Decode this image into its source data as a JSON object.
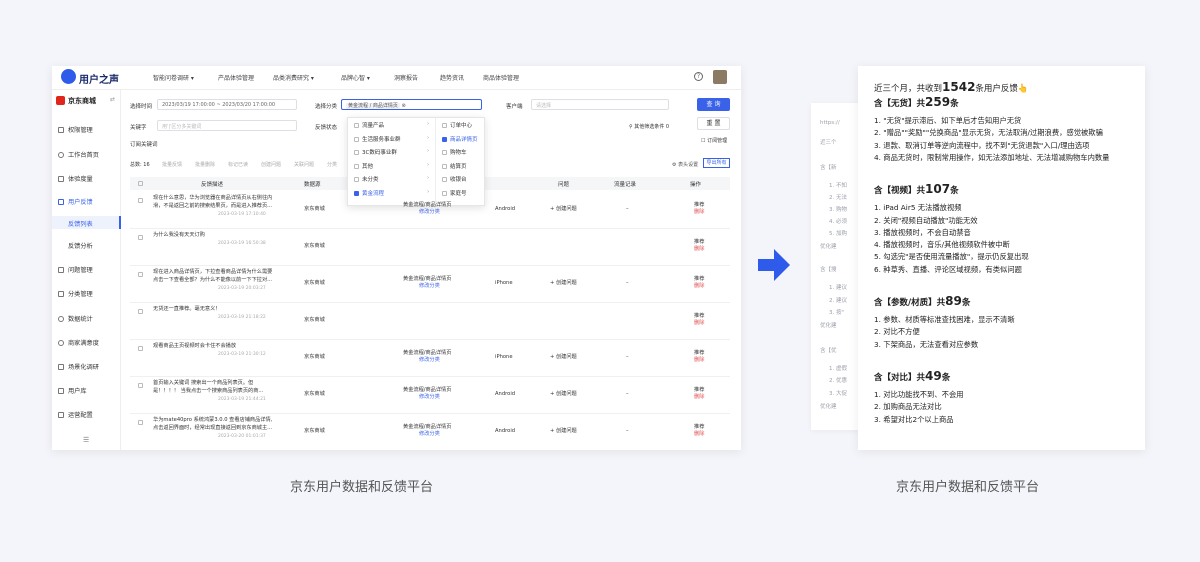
{
  "app": {
    "name": "用户之声",
    "nav": [
      "智能问卷调研 ▾",
      "产品体验管理",
      "品类消费研究 ▾",
      "品牌心智 ▾",
      "洞察报告",
      "趋势资讯",
      "商品体验管理"
    ],
    "help": "?"
  },
  "sidebar": {
    "brand": "京东商城",
    "items": [
      {
        "label": "权限管理",
        "arrow": "›"
      },
      {
        "label": "工作台首页",
        "arrow": ""
      },
      {
        "label": "体验度量",
        "arrow": "›"
      },
      {
        "label": "用户反馈",
        "arrow": "˄"
      },
      {
        "label": "问题管理",
        "arrow": "›"
      },
      {
        "label": "分类管理",
        "arrow": ""
      },
      {
        "label": "数据统计",
        "arrow": "›"
      },
      {
        "label": "商家满意度",
        "arrow": ""
      },
      {
        "label": "场景化调研",
        "arrow": "›"
      },
      {
        "label": "用户库",
        "arrow": "›"
      },
      {
        "label": "运营配置",
        "arrow": "›"
      }
    ],
    "sub_items": [
      "反馈列表",
      "反馈分析"
    ],
    "collapse": "☰"
  },
  "filters": {
    "time_label": "选择时间",
    "time_value": "2023/03/19 17:00:00  ~  2023/03/20 17:00:00",
    "category_label": "选择分类",
    "category_tag": "黄金流程 / 商品详情页",
    "port_label": "客户端",
    "port_placeholder": "请选择",
    "keyword_label": "关键字",
    "keyword_placeholder": "用'|'区分多关键词",
    "status_label": "反馈状态",
    "subscribe_label": "订阅关键词",
    "more_filters": "其他筛选条件 0",
    "subscribe_manage": "订阅管理",
    "search_btn": "查 询",
    "reset_btn": "重 置"
  },
  "toolbar": {
    "total_label": "总数:",
    "total": "16",
    "actions": [
      "批量反馈",
      "批量删除",
      "标记已读",
      "创建问题",
      "关联问题",
      "分类"
    ],
    "header_settings": "表头设置",
    "export": "导出所有"
  },
  "dropdown": {
    "left": [
      {
        "label": "流量产品",
        "checked": false
      },
      {
        "label": "生活服务事业群",
        "checked": false
      },
      {
        "label": "3C数码事业群",
        "checked": false
      },
      {
        "label": "其他",
        "checked": false
      },
      {
        "label": "未分类",
        "checked": false
      },
      {
        "label": "黄金流程",
        "checked": true
      }
    ],
    "right": [
      {
        "label": "订单中心",
        "checked": false
      },
      {
        "label": "商品详情页",
        "checked": true
      },
      {
        "label": "购物车",
        "checked": false
      },
      {
        "label": "结算页",
        "checked": false
      },
      {
        "label": "收银台",
        "checked": false
      },
      {
        "label": "家庭号",
        "checked": false
      }
    ]
  },
  "table": {
    "headers": [
      "反馈描述",
      "数据源",
      "",
      "",
      "",
      "问题",
      "流量记录",
      "操作"
    ],
    "rows": [
      {
        "desc1": "现在什么意思，华为浏览器在商品详情页从右侧往内",
        "desc2": "滑，不是返回之前的搜索结果页，而是进入推荐页...",
        "time": "2023-03-19 17:10:40",
        "source": "京东商城",
        "cat": "黄金流程/商品详情页",
        "edit": "修改分类",
        "os": "Android",
        "create": "+ 创建问题",
        "flow": "–",
        "op1": "推荐",
        "op2": "删除"
      },
      {
        "desc1": "为什么我没有天天订购",
        "desc2": "",
        "time": "2023-03-19 16:50:38",
        "source": "京东商城",
        "cat": "",
        "edit": "",
        "os": "",
        "create": "",
        "flow": "",
        "op1": "推荐",
        "op2": "删除"
      },
      {
        "desc1": "现在进入商品详情页，下拉查看商品详情为什么需要",
        "desc2": "点击一下查看全部？为什么不能像以前一下下拉对...",
        "time": "2023-03-19 20:03:27",
        "source": "京东商城",
        "cat": "黄金流程/商品详情页",
        "edit": "修改分类",
        "os": "iPhone",
        "create": "+ 创建问题",
        "flow": "–",
        "op1": "推荐",
        "op2": "删除"
      },
      {
        "desc1": "无货还一直推荐。毫无意义！",
        "desc2": "",
        "time": "2023-03-19 21:18:22",
        "source": "京东商城",
        "cat": "",
        "edit": "",
        "os": "",
        "create": "",
        "flow": "",
        "op1": "推荐",
        "op2": "删除"
      },
      {
        "desc1": "观看商品主页视频时会卡住不会播放",
        "desc2": "",
        "time": "2023-03-19 21:30:12",
        "source": "京东商城",
        "cat": "黄金流程/商品详情页",
        "edit": "修改分类",
        "os": "iPhone",
        "create": "+ 创建问题",
        "flow": "–",
        "op1": "推荐",
        "op2": "删除"
      },
      {
        "desc1": "首页输入关键词 搜索出一个商品列表页。但",
        "desc2": "是！！！！ 当我点击一个搜索商品列表页的商...",
        "time": "2023-03-19 21:44:21",
        "source": "京东商城",
        "cat": "黄金流程/商品详情页",
        "edit": "修改分类",
        "os": "Android",
        "create": "+ 创建问题",
        "flow": "–",
        "op1": "推荐",
        "op2": "删除"
      },
      {
        "desc1": "华为mate40pro 系统鸿蒙3.0.0 查看店铺商品详情,",
        "desc2": "点击返回界面时，经常出现直接返回到京东商城主...",
        "time": "2023-03-20 01:01:37",
        "source": "京东商城",
        "cat": "黄金流程/商品详情页",
        "edit": "修改分类",
        "os": "Android",
        "create": "+ 创建问题",
        "flow": "–",
        "op1": "推荐",
        "op2": "删除"
      }
    ]
  },
  "captions": {
    "left": "京东用户数据和反馈平台",
    "right": "京东用户数据和反馈平台"
  },
  "background_card": [
    "https://",
    "近三个",
    "含【新",
    "1. 不知",
    "2. 无法",
    "3. 购物",
    "4. 必须",
    "5. 加购",
    "优化建",
    "含【搜",
    "1. 建议",
    "2. 建议",
    "3. 按\"",
    "优化建",
    "含【优",
    "1. 虚假",
    "2. 优惠",
    "3. 大促",
    "优化建"
  ],
  "document": {
    "intro_prefix": "近三个月，共收到",
    "intro_count": "1542",
    "intro_suffix": "条用户反馈👆",
    "sections": [
      {
        "title": "含【无货】共",
        "count": "259",
        "unit": "条",
        "items": [
          "1. \"无货\"提示滞后、如下单后才告知用户无货",
          "2. \"赠品\"\"奖励\"\"兑换商品\"显示无货，无法取消/过期浪费，感觉被欺骗",
          "3. 退款、取消订单等逆向流程中，找不到\"无货退款\"入口/理由选项",
          "4. 商品无货时，限制常用操作，如无法添加地址、无法增减购物车内数量"
        ]
      },
      {
        "title": "含【视频】共",
        "count": "107",
        "unit": "条",
        "items": [
          "1. iPad Air5 无法播放视频",
          "2. 关闭\"视频自动播放\"功能无效",
          "3. 播放视频时，不会自动禁音",
          "4. 播放视频时，音乐/其他视频软件被中断",
          "5. 勾选完\"是否使用流量播放\"，提示仍反复出现",
          "6. 种草秀、直播、评论区域视频，有类似问题"
        ]
      },
      {
        "title": "含【参数/材质】共",
        "count": "89",
        "unit": "条",
        "items": [
          "1. 参数、材质等标准查找困难，显示不清晰",
          "2. 对比不方便",
          "3. 下架商品，无法查看对应参数"
        ]
      },
      {
        "title": "含【对比】共",
        "count": "49",
        "unit": "条",
        "items": [
          "1. 对比功能找不到、不会用",
          "2. 加购商品无法对比",
          "3. 希望对比2个以上商品"
        ]
      }
    ]
  }
}
